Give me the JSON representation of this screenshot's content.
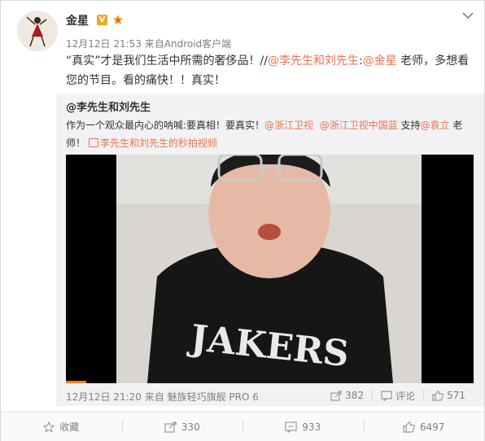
{
  "post": {
    "username": "金星",
    "verified_badge": "V",
    "time": "12月12日 21:53",
    "source_prefix": "来自",
    "source": "Android客户端",
    "text": {
      "part1": "“真实”才是我们生活中所需的奢侈品！//",
      "mention1": "@李先生和刘先生",
      "colon": ":",
      "mention2": "@金星",
      "part2": " 老师，多想看您的节目。看的痛快！！真实！"
    }
  },
  "repost": {
    "username": "@李先生和刘先生",
    "text": {
      "part1": "作为一个观众最内心的呐喊:要真相！要真实！",
      "mention1": "@浙江卫视",
      "mention2": "@浙江卫视中国蓝",
      "part2": " 支持",
      "mention3": "@袁立",
      "part3": " 老师！",
      "video_link": "李先生和刘先生的秒拍视频"
    },
    "video_progress": 0.05,
    "time": "12月12日 21:20",
    "source_prefix": "来自",
    "source": "魅族轻巧旗舰 PRO 6",
    "reposts": "382",
    "comment_label": "评论",
    "likes": "571"
  },
  "actions": {
    "favorite": "收藏",
    "repost": "330",
    "comment": "933",
    "like": "6497"
  },
  "colors": {
    "accent": "#eb7350",
    "progress": "#ff8200",
    "badge": "#f5a623"
  }
}
